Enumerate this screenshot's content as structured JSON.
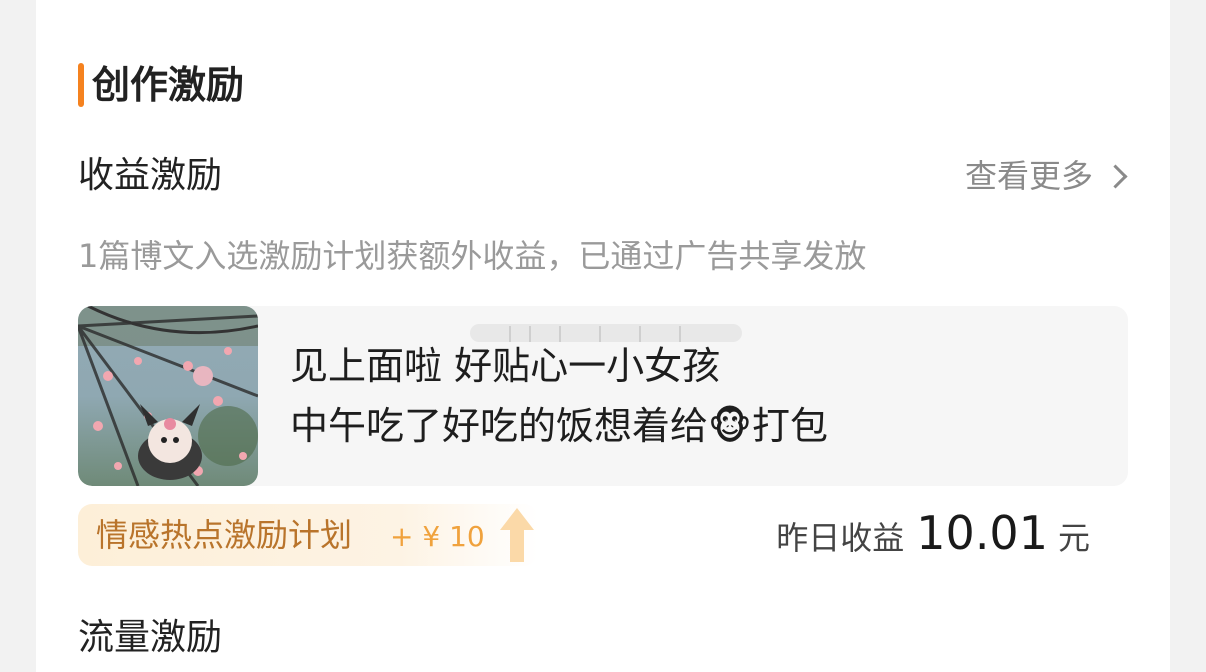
{
  "section": {
    "title": "创作激励",
    "accent_color": "#f5821f"
  },
  "revenue": {
    "title": "收益激励",
    "more_label": "查看更多",
    "description": "1篇博文入选激励计划获额外收益，已通过广告共享发放"
  },
  "post": {
    "line1": "见上面啦 好贴心一小女孩",
    "line2_a": "中午吃了好吃的饭想着给",
    "emoji": "🐵",
    "line2_b": "打包",
    "thumbnail_icon": "umbrella-photo"
  },
  "plan": {
    "name": "情感热点激励计划",
    "amount": "+ ¥ 10",
    "arrow_icon": "up-arrow-icon"
  },
  "earnings": {
    "label": "昨日收益",
    "value": "10.01",
    "unit": "元"
  },
  "traffic": {
    "title": "流量激励"
  }
}
